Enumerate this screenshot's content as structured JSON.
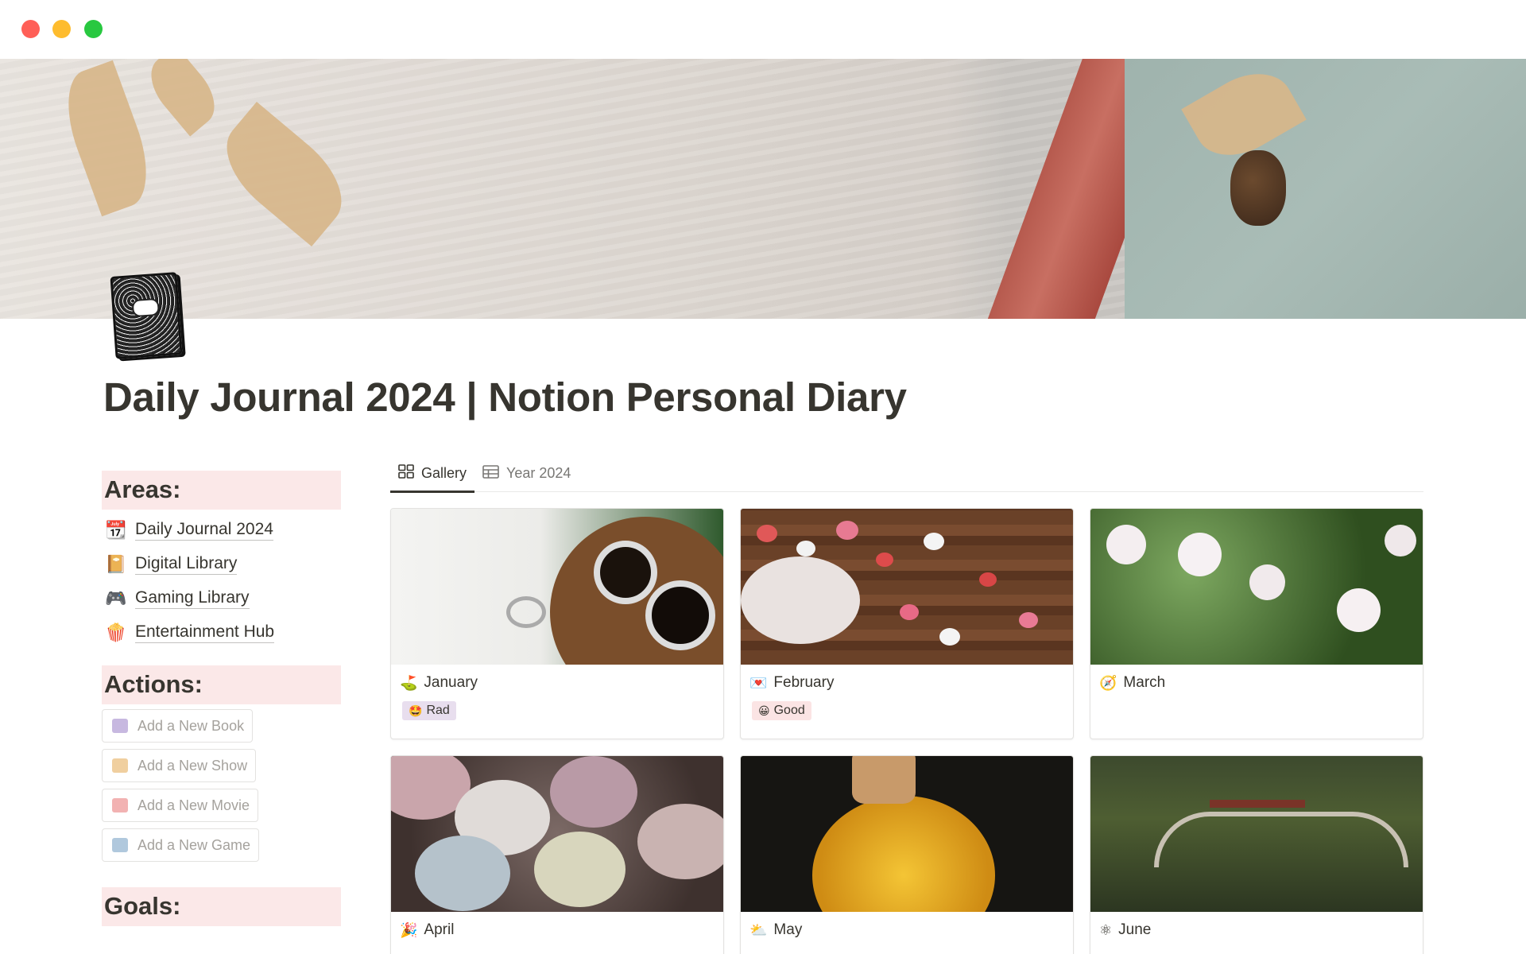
{
  "page": {
    "title": "Daily Journal 2024 | Notion Personal Diary",
    "icon": "composition-notebook-icon"
  },
  "sidebar": {
    "areas_header": "Areas:",
    "areas": [
      {
        "emoji": "📆",
        "label": "Daily Journal 2024"
      },
      {
        "emoji": "📔",
        "label": "Digital Library"
      },
      {
        "emoji": "🎮",
        "label": "Gaming Library"
      },
      {
        "emoji": "🍿",
        "label": "Entertainment Hub"
      }
    ],
    "actions_header": "Actions:",
    "actions": [
      {
        "label": "Add a New Book",
        "icon": "book-icon",
        "color": "#b9a6d6"
      },
      {
        "label": "Add a New Show",
        "icon": "tv-icon",
        "color": "#eec699"
      },
      {
        "label": "Add a New Movie",
        "icon": "clapper-icon",
        "color": "#f1a9a9"
      },
      {
        "label": "Add a New Game",
        "icon": "gamepad-icon",
        "color": "#a7c1d8"
      }
    ],
    "goals_header": "Goals:"
  },
  "tabs": [
    {
      "label": "Gallery",
      "icon": "gallery-icon",
      "active": true
    },
    {
      "label": "Year 2024",
      "icon": "table-icon",
      "active": false
    }
  ],
  "gallery": [
    {
      "emoji": "⛳",
      "name": "January",
      "mood": {
        "emoji": "🤩",
        "label": "Rad",
        "color": "#e8deee"
      }
    },
    {
      "emoji": "💌",
      "name": "February",
      "mood": {
        "emoji": "😀",
        "label": "Good",
        "color": "#fbe4e4"
      }
    },
    {
      "emoji": "🧭",
      "name": "March"
    },
    {
      "emoji": "🎉",
      "name": "April"
    },
    {
      "emoji": "⛅",
      "name": "May"
    },
    {
      "emoji": "⚛",
      "name": "June"
    }
  ]
}
